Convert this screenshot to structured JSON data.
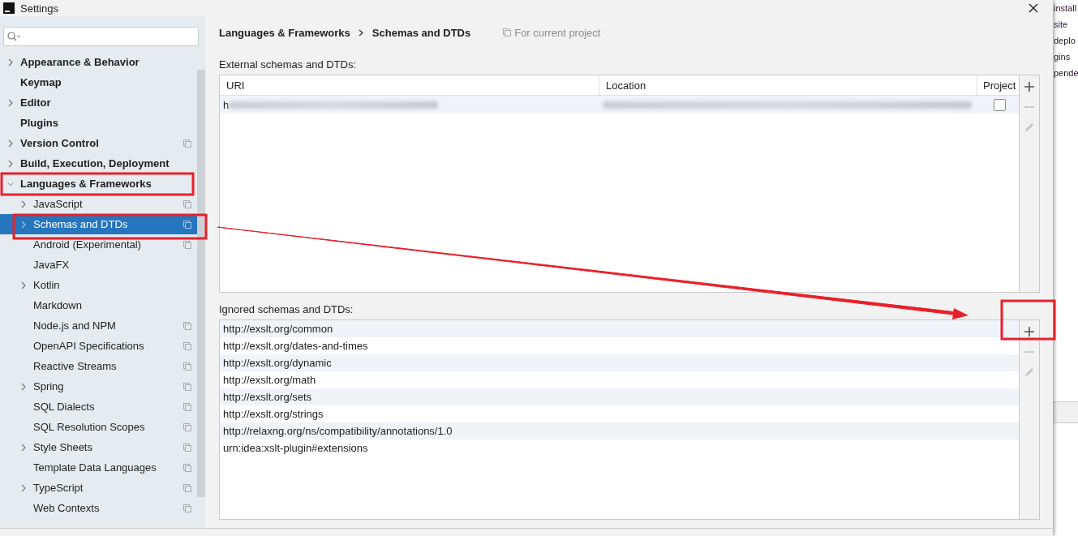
{
  "window": {
    "title": "Settings"
  },
  "sidebar": {
    "items": [
      {
        "label": "Appearance & Behavior",
        "bold": true,
        "expandable": true,
        "expanded": false,
        "project_icon": false,
        "selected": false
      },
      {
        "label": "Keymap",
        "bold": true,
        "expandable": false,
        "project_icon": false,
        "selected": false
      },
      {
        "label": "Editor",
        "bold": true,
        "expandable": true,
        "expanded": false,
        "project_icon": false,
        "selected": false
      },
      {
        "label": "Plugins",
        "bold": true,
        "expandable": false,
        "project_icon": false,
        "selected": false
      },
      {
        "label": "Version Control",
        "bold": true,
        "expandable": true,
        "expanded": false,
        "project_icon": true,
        "selected": false
      },
      {
        "label": "Build, Execution, Deployment",
        "bold": true,
        "expandable": true,
        "expanded": false,
        "project_icon": false,
        "selected": false
      },
      {
        "label": "Languages & Frameworks",
        "bold": true,
        "expandable": true,
        "expanded": true,
        "project_icon": false,
        "selected": false,
        "children": [
          {
            "label": "JavaScript",
            "expandable": true,
            "expanded": false,
            "project_icon": true,
            "selected": false
          },
          {
            "label": "Schemas and DTDs",
            "expandable": true,
            "expanded": false,
            "project_icon": true,
            "selected": true
          },
          {
            "label": "Android (Experimental)",
            "expandable": false,
            "project_icon": true,
            "selected": false
          },
          {
            "label": "JavaFX",
            "expandable": false,
            "project_icon": false,
            "selected": false
          },
          {
            "label": "Kotlin",
            "expandable": true,
            "expanded": false,
            "project_icon": false,
            "selected": false
          },
          {
            "label": "Markdown",
            "expandable": false,
            "project_icon": false,
            "selected": false
          },
          {
            "label": "Node.js and NPM",
            "expandable": false,
            "project_icon": true,
            "selected": false
          },
          {
            "label": "OpenAPI Specifications",
            "expandable": false,
            "project_icon": true,
            "selected": false
          },
          {
            "label": "Reactive Streams",
            "expandable": false,
            "project_icon": true,
            "selected": false
          },
          {
            "label": "Spring",
            "expandable": true,
            "expanded": false,
            "project_icon": true,
            "selected": false
          },
          {
            "label": "SQL Dialects",
            "expandable": false,
            "project_icon": true,
            "selected": false
          },
          {
            "label": "SQL Resolution Scopes",
            "expandable": false,
            "project_icon": true,
            "selected": false
          },
          {
            "label": "Style Sheets",
            "expandable": true,
            "expanded": false,
            "project_icon": true,
            "selected": false
          },
          {
            "label": "Template Data Languages",
            "expandable": false,
            "project_icon": true,
            "selected": false
          },
          {
            "label": "TypeScript",
            "expandable": true,
            "expanded": false,
            "project_icon": true,
            "selected": false
          },
          {
            "label": "Web Contexts",
            "expandable": false,
            "project_icon": true,
            "selected": false
          }
        ]
      }
    ]
  },
  "breadcrumb": [
    "Languages & Frameworks",
    "Schemas and DTDs"
  ],
  "scope_note": "For current project",
  "external": {
    "label": "External schemas and DTDs:",
    "columns": [
      "URI",
      "Location",
      "Project"
    ],
    "rows": [
      {
        "uri": "h",
        "blurred": true,
        "checked": false
      }
    ]
  },
  "ignored": {
    "label": "Ignored schemas and DTDs:",
    "rows": [
      "http://exslt.org/common",
      "http://exslt.org/dates-and-times",
      "http://exslt.org/dynamic",
      "http://exslt.org/math",
      "http://exslt.org/sets",
      "http://exslt.org/strings",
      "http://relaxng.org/ns/compatibility/annotations/1.0",
      "urn:idea:xslt-plugin#extensions"
    ]
  },
  "toolbar": [
    {
      "kind": "add",
      "disabled": false
    },
    {
      "kind": "remove",
      "disabled": true
    },
    {
      "kind": "edit",
      "disabled": true
    }
  ],
  "background_window": {
    "lines": [
      "install",
      "site",
      "deplo",
      "gins",
      "pende"
    ]
  },
  "annotations": [
    {
      "kind": "box"
    },
    {
      "kind": "box"
    },
    {
      "kind": "box"
    },
    {
      "kind": "arrow"
    }
  ]
}
